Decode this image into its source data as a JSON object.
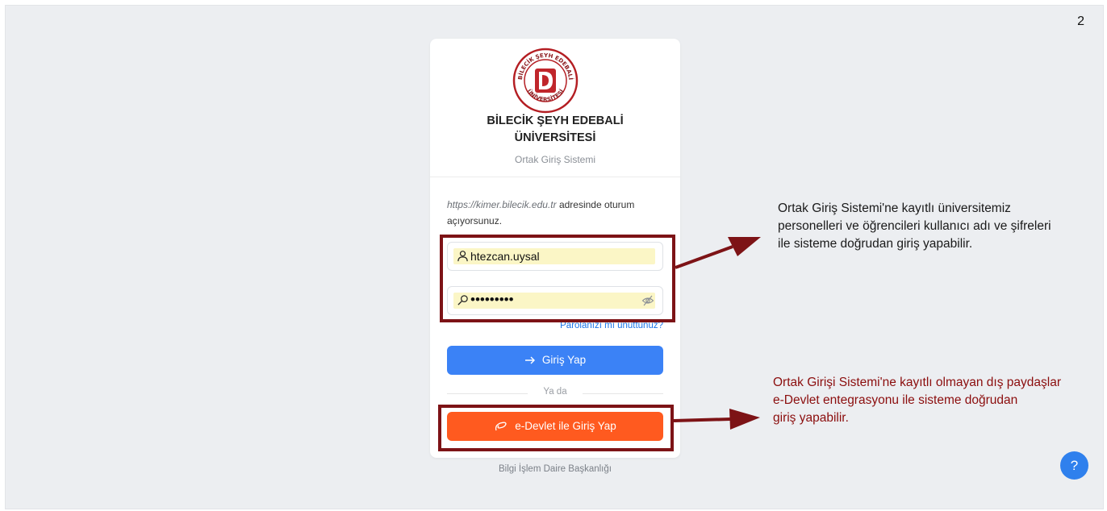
{
  "slide": {
    "page_number": "2"
  },
  "login_card": {
    "logo_text_top": "BİLECİK ŞEYH EDEBALİ",
    "logo_text_bottom": "ÜNİVERSİTESİ",
    "university_line1": "BİLECİK ŞEYH EDEBALİ",
    "university_line2": "ÜNİVERSİTESİ",
    "system_name": "Ortak Giriş Sistemi",
    "info_url": "https://kimer.bilecik.edu.tr",
    "info_rest": " adresinde oturum açıyorsunuz.",
    "username_value": "htezcan.uysal",
    "password_value": "•••••••••",
    "forgot_link": "Parolanızı mı unuttunuz?",
    "login_button": "Giriş Yap",
    "or_label": "Ya da",
    "edevlet_button": "e-Devlet ile Giriş Yap",
    "footer": "Bilgi İşlem Daire Başkanlığı"
  },
  "annotations": {
    "credentials_note_lines": [
      "Ortak Giriş Sistemi'ne kayıtlı üniversitemiz",
      "personelleri ve öğrencileri kullanıcı adı ve şifreleri",
      "ile sisteme doğrudan giriş yapabilir."
    ],
    "edevlet_note_lines": [
      "Ortak Girişi Sistemi'ne kayıtlı olmayan dış paydaşlar",
      "e-Devlet entegrasyonu ile sisteme doğrudan",
      "giriş yapabilir."
    ]
  },
  "help_button": {
    "label": "?"
  },
  "colors": {
    "highlight_box": "#7d1316",
    "login_button": "#3b82f6",
    "edevlet_button": "#ff5a1f",
    "red_note": "#8b0d0d",
    "help_button": "#2f80ed"
  },
  "icons": {
    "username_field": "user-icon",
    "password_field": "key-icon",
    "password_toggle": "eye-off-icon",
    "login_button": "arrow-right-icon",
    "edevlet_button": "edevlet-swirl-icon"
  }
}
